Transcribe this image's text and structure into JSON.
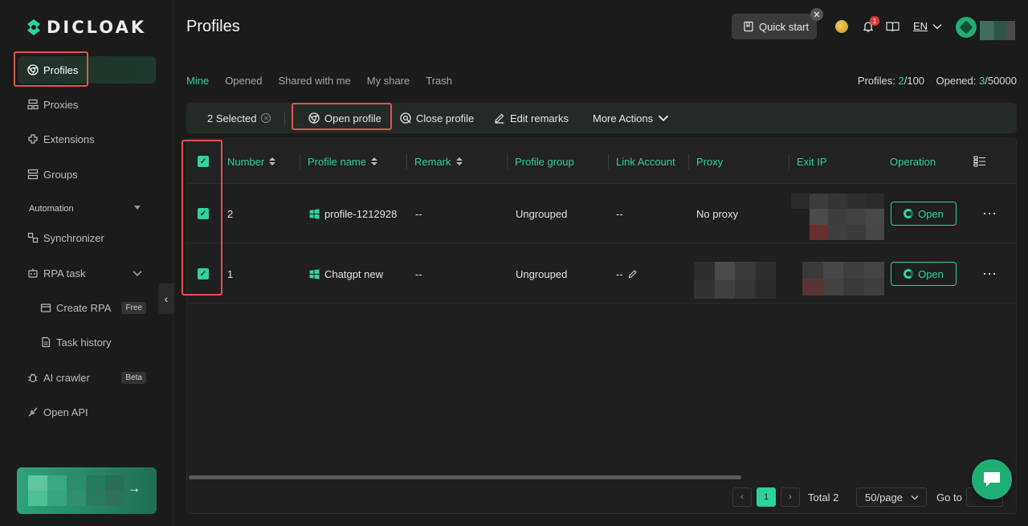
{
  "brand": {
    "name": "DICLOAK"
  },
  "sidebar": {
    "items": [
      {
        "label": "Profiles",
        "icon": "chrome-icon"
      },
      {
        "label": "Proxies",
        "icon": "proxy-icon"
      },
      {
        "label": "Extensions",
        "icon": "extension-icon"
      },
      {
        "label": "Groups",
        "icon": "groups-icon"
      }
    ],
    "automation_label": "Automation",
    "automation_items": [
      {
        "label": "Synchronizer",
        "icon": "sync-icon"
      },
      {
        "label": "RPA task",
        "icon": "robot-icon"
      },
      {
        "label": "Create RPA",
        "badge": "Free",
        "icon": "create-rpa-icon"
      },
      {
        "label": "Task history",
        "icon": "document-icon"
      },
      {
        "label": "AI crawler",
        "badge": "Beta",
        "icon": "bug-icon"
      },
      {
        "label": "Open API",
        "icon": "api-icon"
      }
    ]
  },
  "header": {
    "title": "Profiles",
    "quick_start": "Quick start",
    "notification_count": "1",
    "language": "EN"
  },
  "tabs": [
    "Mine",
    "Opened",
    "Shared with me",
    "My share",
    "Trash"
  ],
  "counts": {
    "profiles_label": "Profiles:",
    "profiles_used": "2",
    "profiles_total": "/100",
    "opened_label": "Opened:",
    "opened_used": "3",
    "opened_total": "/50000"
  },
  "toolbar": {
    "selected": "2 Selected",
    "open_profile": "Open profile",
    "close_profile": "Close profile",
    "edit_remarks": "Edit remarks",
    "more_actions": "More Actions"
  },
  "table": {
    "columns": [
      "Number",
      "Profile name",
      "Remark",
      "Profile group",
      "Link Account",
      "Proxy",
      "Exit IP",
      "Operation"
    ],
    "rows": [
      {
        "number": "2",
        "name": "profile-1212928",
        "remark": "--",
        "group": "Ungrouped",
        "link": "--",
        "proxy": "No proxy",
        "action": "Open"
      },
      {
        "number": "1",
        "name": "Chatgpt new",
        "remark": "--",
        "group": "Ungrouped",
        "link": "--",
        "proxy": "",
        "action": "Open"
      }
    ]
  },
  "pagination": {
    "current": "1",
    "total": "Total 2",
    "page_size": "50/page",
    "goto": "Go to"
  },
  "colors": {
    "accent": "#2ed39a",
    "highlight": "#e25353",
    "background": "#1b1b1b"
  }
}
